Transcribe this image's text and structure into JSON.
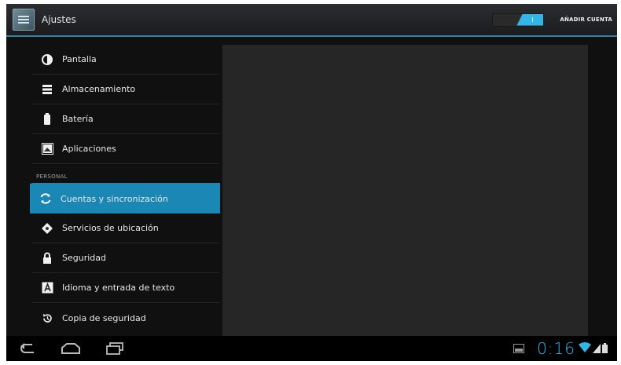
{
  "app": {
    "title": "Ajustes",
    "toggle_state": "I",
    "add_account": "AÑADIR CUENTA"
  },
  "sidebar": {
    "items_top": [
      {
        "label": "Pantalla",
        "icon": "brightness-icon"
      },
      {
        "label": "Almacenamiento",
        "icon": "storage-icon"
      },
      {
        "label": "Batería",
        "icon": "battery-icon"
      },
      {
        "label": "Aplicaciones",
        "icon": "apps-icon"
      }
    ],
    "section_header": "PERSONAL",
    "items_personal": [
      {
        "label": "Cuentas y sincronización",
        "icon": "sync-icon",
        "selected": true
      },
      {
        "label": "Servicios de ubicación",
        "icon": "location-icon"
      },
      {
        "label": "Seguridad",
        "icon": "lock-icon"
      },
      {
        "label": "Idioma y entrada de texto",
        "icon": "language-icon"
      },
      {
        "label": "Copia de seguridad",
        "icon": "backup-icon"
      }
    ]
  },
  "status_bar": {
    "time": "0:16",
    "nav_icons": [
      "back-icon",
      "home-icon",
      "recent-apps-icon"
    ],
    "status_icons": [
      "screenshot-notification-icon",
      "wifi-icon",
      "signal-icon",
      "battery-status-icon"
    ]
  },
  "colors": {
    "accent": "#33b5e5",
    "selected_item": "#1b87b4",
    "background": "#101010",
    "detail_pane": "#262626"
  }
}
